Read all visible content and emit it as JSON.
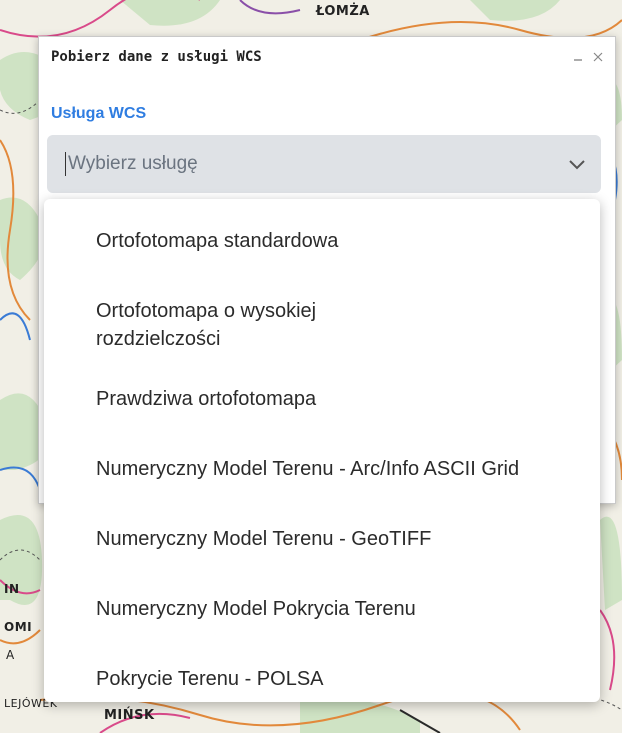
{
  "map": {
    "labels": {
      "top_city": "ŁOMŻA",
      "left_city1": "IN",
      "left_city2": "OMI",
      "left_city3": "A",
      "bottom_left": "LEJÓWEK",
      "bottom_city": "MIŃSK"
    }
  },
  "dialog": {
    "title": "Pobierz dane z usługi WCS",
    "minimize_icon": "minimize-icon",
    "close_icon": "close-icon",
    "section_label": "Usługa WCS",
    "select": {
      "placeholder": "Wybierz usługę",
      "chevron_icon": "chevron-down-icon"
    }
  },
  "dropdown": {
    "options": [
      "Ortofotomapa standardowa",
      "Ortofotomapa o wysokiej rozdzielczości",
      "Prawdziwa ortofotomapa",
      "Numeryczny Model Terenu - Arc/Info ASCII Grid",
      "Numeryczny Model Terenu - GeoTIFF",
      "Numeryczny Model Pokrycia Terenu",
      "Pokrycie Terenu - POLSA"
    ]
  },
  "colors": {
    "accent": "#2f7de1",
    "select_bg": "#dfe2e6",
    "map_bg": "#f1efe6"
  }
}
